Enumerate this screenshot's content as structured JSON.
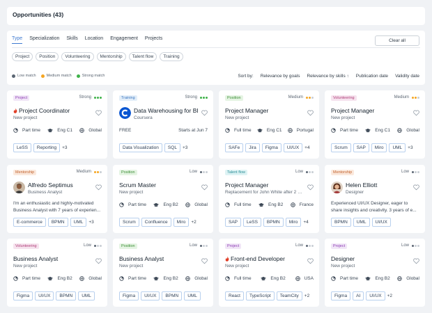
{
  "header": {
    "title": "Opportunities (43)"
  },
  "filters": {
    "tabs": [
      {
        "label": "Type",
        "active": true
      },
      {
        "label": "Specialization"
      },
      {
        "label": "Skills"
      },
      {
        "label": "Location"
      },
      {
        "label": "Engagement"
      },
      {
        "label": "Projects"
      }
    ],
    "clear_label": "Clear all",
    "chips": [
      "Project",
      "Position",
      "Volunteering",
      "Mentorship",
      "Talent flow",
      "Training"
    ],
    "legend": [
      {
        "label": "Low match",
        "color": "#5b6673"
      },
      {
        "label": "Medium match",
        "color": "#f5a623"
      },
      {
        "label": "Strong match",
        "color": "#3fb24a"
      }
    ],
    "sort": {
      "label": "Sort by:",
      "options": [
        "Relevance by goals",
        "Relevance by skills ↑",
        "Publication date",
        "Validity date"
      ]
    }
  },
  "colors": {
    "accent": "#3f7ad0",
    "badges": {
      "Project": {
        "bg": "#f1e6f7",
        "fg": "#8d3cb4"
      },
      "Training": {
        "bg": "#e3eef9",
        "fg": "#3a77c0"
      },
      "Position": {
        "bg": "#e5f4e3",
        "fg": "#3d8f37"
      },
      "Volunteering": {
        "bg": "#f6e3ee",
        "fg": "#b0407a"
      },
      "Mentorship": {
        "bg": "#fbe9dd",
        "fg": "#c2622d"
      },
      "Talent flow": {
        "bg": "#def3f4",
        "fg": "#2b8f98"
      }
    },
    "match": {
      "Strong": "#3fb24a",
      "Medium": "#f5a623",
      "Low": "#5b6673"
    }
  },
  "cards": [
    {
      "badge": "Project",
      "match": "Strong",
      "title": "Project Coordinator",
      "flame": true,
      "subtitle": "New project",
      "meta": [
        "Part time",
        "Eng C1",
        "Global"
      ],
      "tags": [
        "LeSS",
        "Reporting"
      ],
      "more": "+3"
    },
    {
      "badge": "Training",
      "match": "Strong",
      "title": "Data Warehousing for BI",
      "logo": "coursera-icon",
      "subtitle": "Coursera",
      "free": {
        "left": "FREE",
        "right": "Starts at Jun 7"
      },
      "tags": [
        "Data Visualization",
        "SQL"
      ],
      "more": "+3"
    },
    {
      "badge": "Position",
      "match": "Medium",
      "title": "Project Manager",
      "subtitle": "New project",
      "meta": [
        "Full time",
        "Eng C1",
        "Portugal"
      ],
      "tags": [
        "SAFe",
        "Jira",
        "Figma",
        "UI/UX"
      ],
      "more": "+4"
    },
    {
      "badge": "Volunteering",
      "match": "Medium",
      "title": "Project Manager",
      "subtitle": "New project",
      "meta": [
        "Part time",
        "Eng C1",
        "Global"
      ],
      "tags": [
        "Scrum",
        "SAP",
        "Miro",
        "UML"
      ],
      "more": "+3"
    },
    {
      "badge": "Mentorship",
      "match": "Medium",
      "title": "Alfredo Septimus",
      "avatar": "male",
      "subtitle": "Business Analyst",
      "desc": [
        "I'm an enthusiastic and highly-motivated",
        "Business Analyst with 7 years of experien..."
      ],
      "tags": [
        "E-commerce",
        "BPMN",
        "UML"
      ],
      "more": "+3"
    },
    {
      "badge": "Position",
      "match": "Low",
      "title": "Scrum Master",
      "subtitle": "New project",
      "meta": [
        "Part time",
        "Eng B2",
        "Global"
      ],
      "tags": [
        "Scrum",
        "Confluence",
        "Miro"
      ],
      "more": "+2"
    },
    {
      "badge": "Talent flow",
      "match": "Low",
      "title": "Project Manager",
      "subtitle": "Replacement for John White after 2 mont...",
      "meta": [
        "Full time",
        "Eng B2",
        "France"
      ],
      "tags": [
        "SAP",
        "LeSS",
        "BPMN",
        "Miro"
      ],
      "more": "+4"
    },
    {
      "badge": "Mentorship",
      "match": "Low",
      "title": "Helen Elliott",
      "avatar": "female",
      "subtitle": "Designer",
      "desc": [
        "Experienced UI/UX Designer, eager to",
        "share insights and creativity. 3 years of e..."
      ],
      "tags": [
        "BPMN",
        "UML",
        "UI/UX"
      ],
      "more": ""
    },
    {
      "badge": "Volunteering",
      "match": "Low",
      "title": "Business Analyst",
      "subtitle": "New project",
      "meta": [
        "Part time",
        "Eng B2",
        "Global"
      ],
      "tags": [
        "Figma",
        "UI/UX",
        "BPMN",
        "UML"
      ],
      "more": ""
    },
    {
      "badge": "Position",
      "match": "Low",
      "title": "Business Analyst",
      "subtitle": "New project",
      "meta": [
        "Part time",
        "Eng B2",
        "Global"
      ],
      "tags": [
        "Figma",
        "UI/UX",
        "BPMN",
        "UML"
      ],
      "more": ""
    },
    {
      "badge": "Project",
      "match": "Low",
      "title": "Front-end Developer",
      "flame": true,
      "subtitle": "New project",
      "meta": [
        "Full time",
        "Eng B2",
        "USA"
      ],
      "tags": [
        "React",
        "TypeScript",
        "TeamCity"
      ],
      "more": "+2"
    },
    {
      "badge": "Project",
      "match": "Low",
      "title": "Designer",
      "subtitle": "New project",
      "meta": [
        "Part time",
        "Eng B2",
        "Global"
      ],
      "tags": [
        "Figma",
        "AI",
        "UI/UX"
      ],
      "more": "+2"
    }
  ]
}
